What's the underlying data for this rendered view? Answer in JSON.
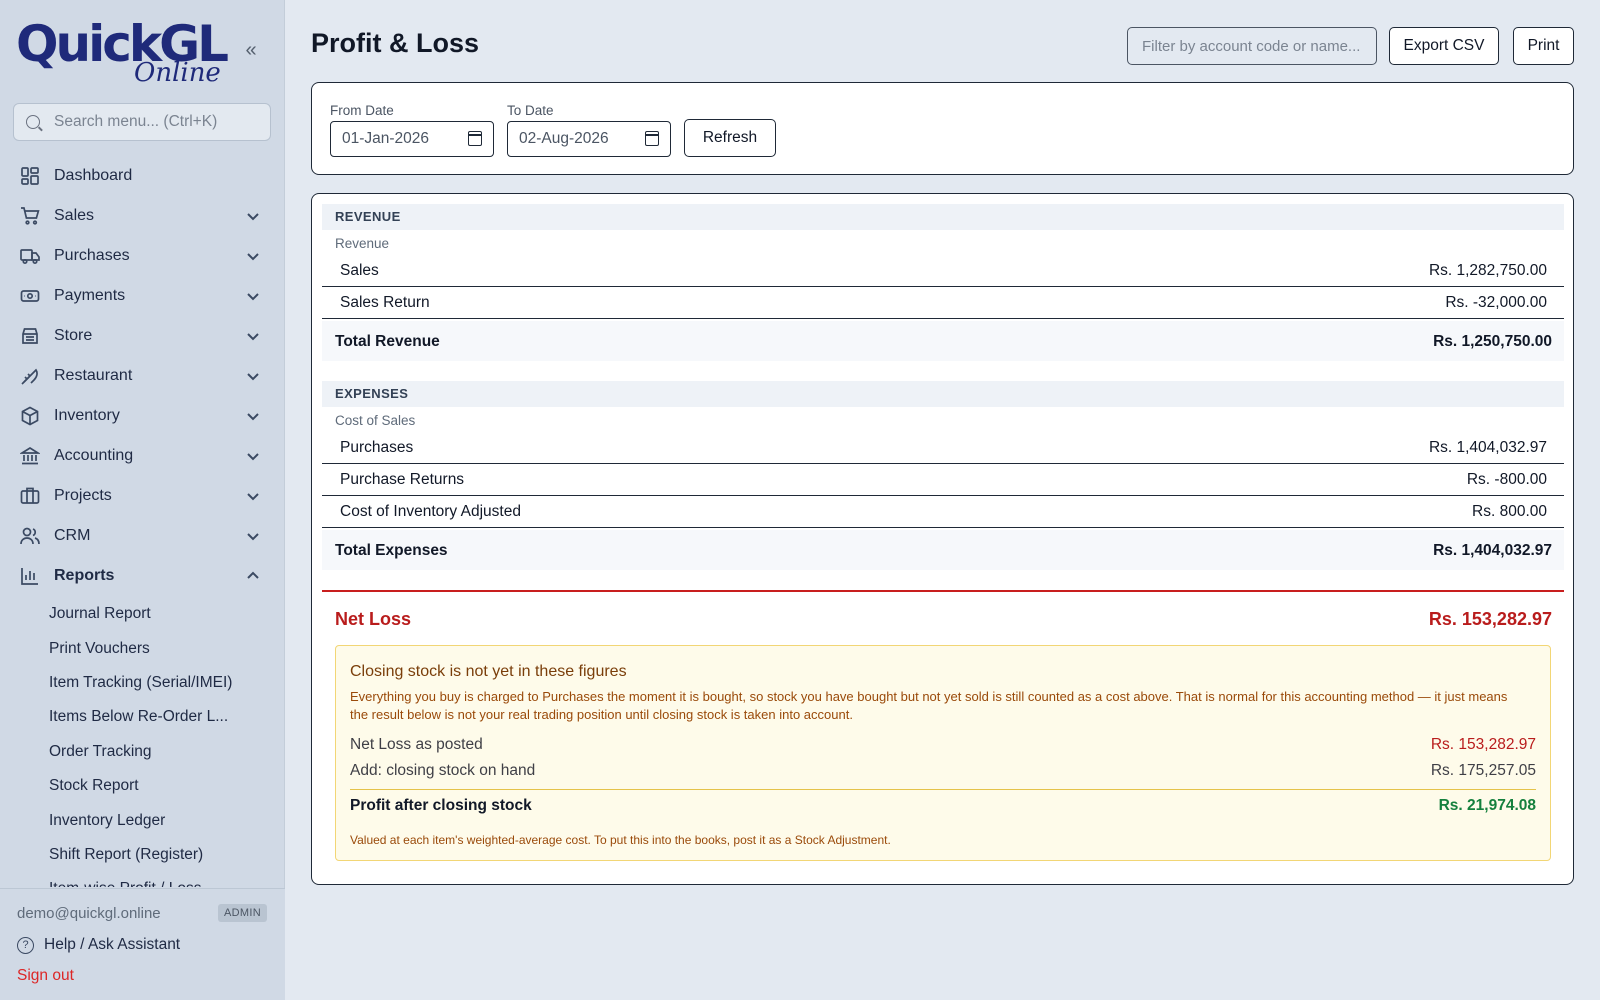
{
  "sidebar": {
    "logo_main": "QuickGL",
    "logo_sub": "Online",
    "collapse_icon": "«",
    "search_placeholder": "Search menu... (Ctrl+K)",
    "items": [
      {
        "label": "Dashboard",
        "icon": "dashboard-icon"
      },
      {
        "label": "Sales",
        "icon": "cart-icon"
      },
      {
        "label": "Purchases",
        "icon": "truck-icon"
      },
      {
        "label": "Payments",
        "icon": "money-icon"
      },
      {
        "label": "Store",
        "icon": "store-icon"
      },
      {
        "label": "Restaurant",
        "icon": "restaurant-icon"
      },
      {
        "label": "Inventory",
        "icon": "box-icon"
      },
      {
        "label": "Accounting",
        "icon": "bank-icon"
      },
      {
        "label": "Projects",
        "icon": "briefcase-icon"
      },
      {
        "label": "CRM",
        "icon": "users-icon"
      },
      {
        "label": "Reports",
        "icon": "bar-chart-icon"
      }
    ],
    "report_items": [
      "Journal Report",
      "Print Vouchers",
      "Item Tracking (Serial/IMEI)",
      "Items Below Re-Order L...",
      "Order Tracking",
      "Stock Report",
      "Inventory Ledger",
      "Shift Report (Register)",
      "Item-wise Profit / Loss"
    ],
    "user_email": "demo@quickgl.online",
    "role": "ADMIN",
    "help": "Help / Ask Assistant",
    "signout": "Sign out"
  },
  "header": {
    "title": "Profit & Loss",
    "filter_placeholder": "Filter by account code or name...",
    "export_label": "Export CSV",
    "print_label": "Print"
  },
  "dates": {
    "from_label": "From Date",
    "from_value": "01-Jan-2026",
    "to_label": "To Date",
    "to_value": "02-Aug-2026",
    "refresh_label": "Refresh"
  },
  "report": {
    "revenue": {
      "heading": "REVENUE",
      "group": "Revenue",
      "rows": [
        {
          "label": "Sales",
          "amount": "Rs. 1,282,750.00"
        },
        {
          "label": "Sales Return",
          "amount": "Rs. -32,000.00"
        }
      ],
      "total_label": "Total Revenue",
      "total_amount": "Rs. 1,250,750.00"
    },
    "expenses": {
      "heading": "EXPENSES",
      "group": "Cost of Sales",
      "rows": [
        {
          "label": "Purchases",
          "amount": "Rs. 1,404,032.97"
        },
        {
          "label": "Purchase Returns",
          "amount": "Rs. -800.00"
        },
        {
          "label": "Cost of Inventory Adjusted",
          "amount": "Rs. 800.00"
        }
      ],
      "total_label": "Total Expenses",
      "total_amount": "Rs. 1,404,032.97"
    },
    "net": {
      "label": "Net Loss",
      "amount": "Rs. 153,282.97"
    },
    "notice": {
      "title": "Closing stock is not yet in these figures",
      "body": "Everything you buy is charged to Purchases the moment it is bought, so stock you have bought but not yet sold is still counted as a cost above. That is normal for this accounting method — it just means the result below is not your real trading position until closing stock is taken into account.",
      "posted_label": "Net Loss as posted",
      "posted_amount": "Rs. 153,282.97",
      "stock_label": "Add: closing stock on hand",
      "stock_amount": "Rs. 175,257.05",
      "profit_label": "Profit after closing stock",
      "profit_amount": "Rs. 21,974.08",
      "footnote": "Valued at each item's weighted-average cost. To put this into the books, post it as a Stock Adjustment."
    }
  },
  "colors": {
    "loss": "#b91c1c",
    "profit": "#15803d",
    "notice_bg": "#fefbea",
    "sidebar_bg": "#d0d9e5"
  }
}
